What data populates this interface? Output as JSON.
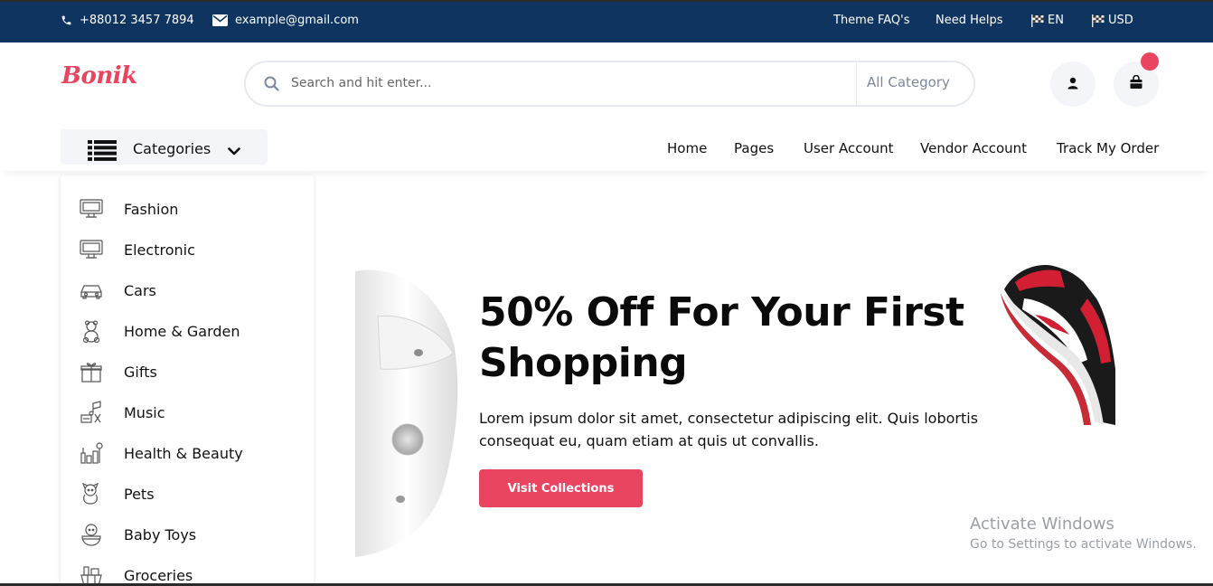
{
  "topbar": {
    "phone": "+88012 3457 7894",
    "email": "example@gmail.com",
    "theme_faq": "Theme FAQ's",
    "need_help": "Need Helps",
    "language": "EN",
    "currency": "USD"
  },
  "header": {
    "logo": "Bonik",
    "search_placeholder": "Search and hit enter...",
    "search_category": "All Category",
    "categories_label": "Categories"
  },
  "nav": {
    "items": [
      "Home",
      "Pages",
      "User Account",
      "Vendor Account",
      "Track My Order"
    ]
  },
  "categories": [
    {
      "label": "Fashion",
      "icon": "monitor-icon"
    },
    {
      "label": "Electronic",
      "icon": "monitor-icon"
    },
    {
      "label": "Cars",
      "icon": "car-icon"
    },
    {
      "label": "Home & Garden",
      "icon": "teddy-bear-icon"
    },
    {
      "label": "Gifts",
      "icon": "gift-icon"
    },
    {
      "label": "Music",
      "icon": "music-icon"
    },
    {
      "label": "Health & Beauty",
      "icon": "cosmetics-icon"
    },
    {
      "label": "Pets",
      "icon": "pet-icon"
    },
    {
      "label": "Baby Toys",
      "icon": "baby-icon"
    },
    {
      "label": "Groceries",
      "icon": "basket-icon"
    }
  ],
  "hero": {
    "title_line1": "50% Off For Your First",
    "title_line2": "Shopping",
    "description": "Lorem ipsum dolor sit amet, consectetur adipiscing elit. Quis lobortis consequat eu, quam etiam at quis ut convallis.",
    "button": "Visit Collections"
  },
  "watermark": {
    "line1": "Activate Windows",
    "line2": "Go to Settings to activate Windows."
  },
  "colors": {
    "topbar": "#0f3460",
    "accent": "#e94560",
    "light_bg": "#f3f5f9"
  }
}
